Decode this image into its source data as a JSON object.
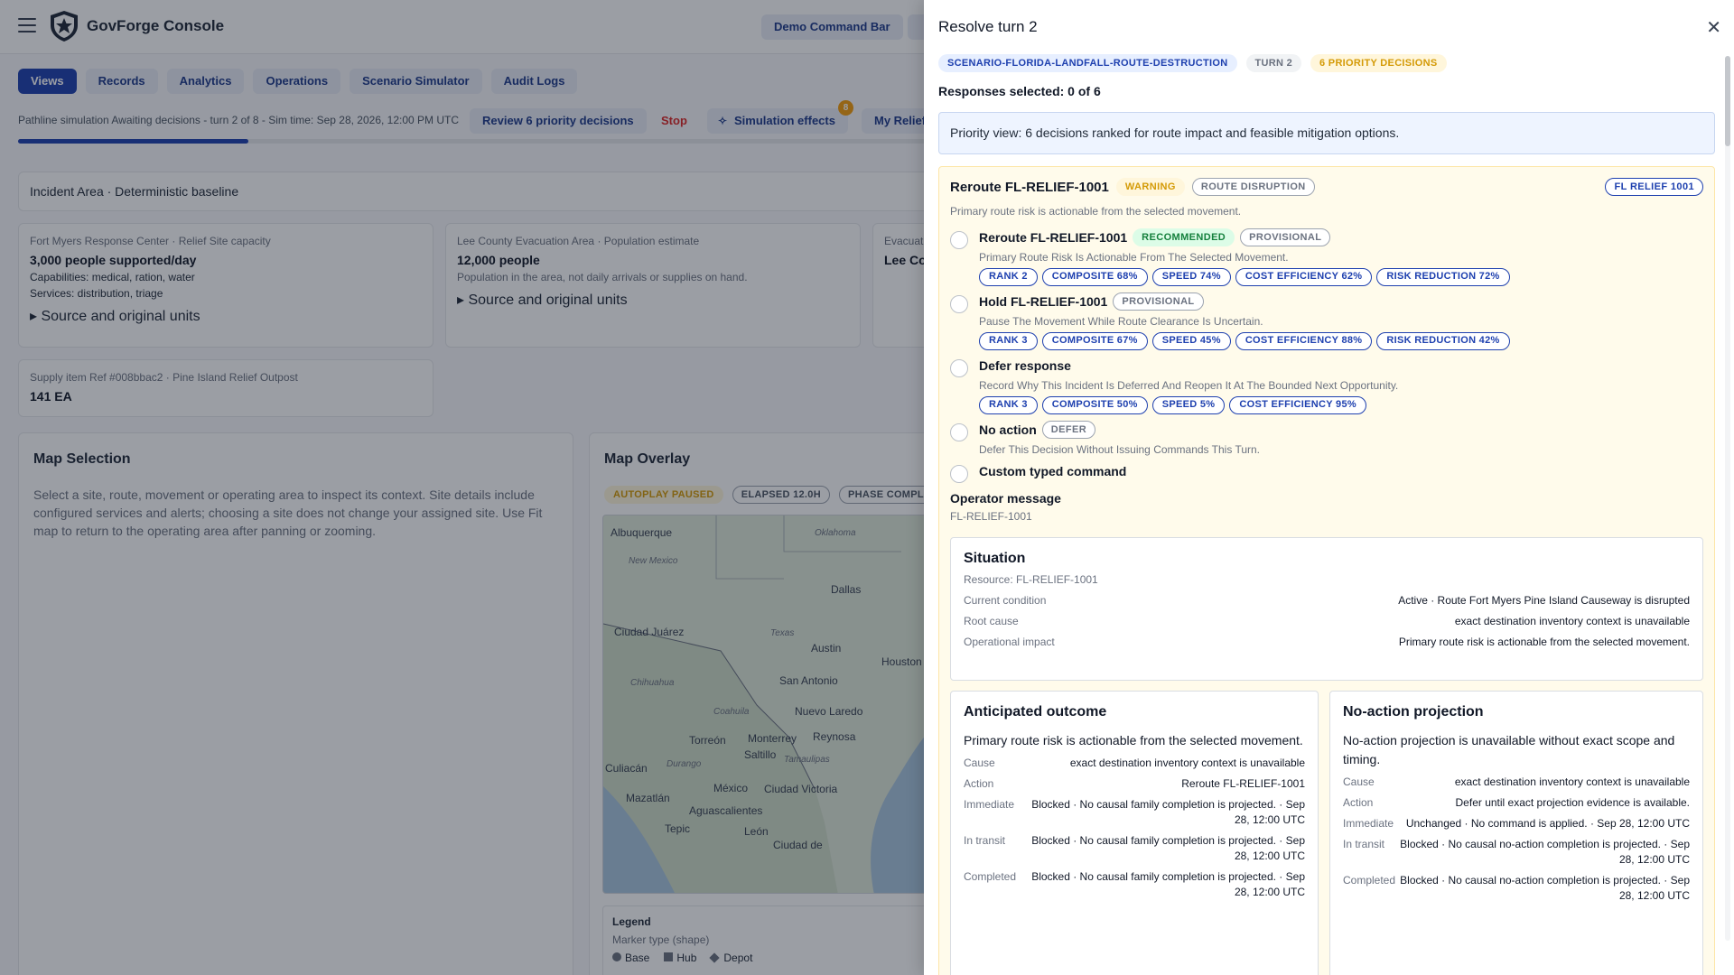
{
  "app": {
    "name": "GovForge Console",
    "demo_label": "Demo Command Bar"
  },
  "tabs": [
    "Views",
    "Records",
    "Analytics",
    "Operations",
    "Scenario Simulator",
    "Audit Logs"
  ],
  "sim": {
    "status_line": "Pathline simulation Awaiting decisions - turn 2 of 8 - Sim time: Sep 28, 2026, 12:00 PM UTC",
    "review_label": "Review 6 priority decisions",
    "stop_label": "Stop",
    "effects_label": "Simulation effects",
    "effects_badge": "8",
    "relief_label": "My Relief S",
    "progress": 0.25
  },
  "incident": "Incident Area · Deterministic baseline",
  "cards": [
    {
      "title": "Fort Myers Response Center · Relief Site capacity",
      "value": "3,000 people supported/day",
      "line1": "Capabilities: medical, ration, water",
      "line2": "Services: distribution, triage",
      "source": "Source and original units"
    },
    {
      "title": "Lee County Evacuation Area · Population estimate",
      "value": "12,000 people",
      "line1": "Population in the area, not daily arrivals or supplies on hand.",
      "source": "Source and original units"
    },
    {
      "title": "Evacuat",
      "value": "Lee Co"
    },
    {
      "title": "Supply item Ref #008bbac2 · Pine Island Relief Outpost",
      "value": "141 EA"
    }
  ],
  "map_selection": {
    "title": "Map Selection",
    "text": "Select a site, route, movement or operating area to inspect its context. Site details include configured services and alerts; choosing a site does not change your assigned site. Use Fit map to return to the operating area after panning or zooming."
  },
  "map_overlay": {
    "title": "Map Overlay",
    "pills": [
      "AUTOPLAY PAUSED",
      "ELAPSED 12.0H",
      "PHASE COMPL"
    ],
    "labels": [
      "Albuquerque",
      "Oklahoma",
      "New Mexico",
      "Dallas",
      "Ciudad Juárez",
      "Texas",
      "Austin",
      "Houston",
      "Chihuahua",
      "San Antonio",
      "Coahuila",
      "Nuevo Laredo",
      "Torreón",
      "Monterrey",
      "Reynosa",
      "Saltillo",
      "Culiacán",
      "Durango",
      "Tamaulipas",
      "México",
      "Mazatlán",
      "Ciudad Victoria",
      "Aguascalientes",
      "Tepic",
      "León",
      "Ciudad de"
    ],
    "legend": {
      "title": "Legend",
      "subtitle": "Marker type (shape)",
      "items": [
        "Base",
        "Hub",
        "Depot"
      ]
    }
  },
  "drawer": {
    "title": "Resolve turn 2",
    "pills": [
      "SCENARIO-FLORIDA-LANDFALL-ROUTE-DESTRUCTION",
      "TURN 2",
      "6 PRIORITY DECISIONS"
    ],
    "responses": "Responses selected: 0 of 6",
    "priority": "Priority view: 6 decisions ranked for route impact and feasible mitigation options.",
    "decision": {
      "title": "Reroute FL-RELIEF-1001",
      "severity": "WARNING",
      "category": "ROUTE DISRUPTION",
      "resource": "FL RELIEF 1001",
      "summary": "Primary route risk is actionable from the selected movement.",
      "options": [
        {
          "title": "Reroute FL-RELIEF-1001",
          "tags": [
            "RECOMMENDED",
            "PROVISIONAL"
          ],
          "desc": "Primary Route Risk Is Actionable From The Selected Movement.",
          "metrics": [
            "RANK 2",
            "COMPOSITE 68%",
            "SPEED 74%",
            "COST EFFICIENCY 62%",
            "RISK REDUCTION 72%"
          ]
        },
        {
          "title": "Hold FL-RELIEF-1001",
          "tags": [
            "PROVISIONAL"
          ],
          "desc": "Pause The Movement While Route Clearance Is Uncertain.",
          "metrics": [
            "RANK 3",
            "COMPOSITE 67%",
            "SPEED 45%",
            "COST EFFICIENCY 88%",
            "RISK REDUCTION 42%"
          ]
        },
        {
          "title": "Defer response",
          "tags": [],
          "desc": "Record Why This Incident Is Deferred And Reopen It At The Bounded Next Opportunity.",
          "metrics": [
            "RANK 3",
            "COMPOSITE 50%",
            "SPEED 5%",
            "COST EFFICIENCY 95%"
          ]
        },
        {
          "title": "No action",
          "tags": [
            "DEFER"
          ],
          "desc": "Defer This Decision Without Issuing Commands This Turn.",
          "metrics": []
        },
        {
          "title": "Custom typed command",
          "tags": [],
          "desc": "",
          "metrics": []
        }
      ],
      "operator_message": {
        "label": "Operator message",
        "value": "FL-RELIEF-1001"
      },
      "situation": {
        "title": "Situation",
        "resource": "Resource: FL-RELIEF-1001",
        "rows": [
          {
            "k": "Current condition",
            "v": "Active · Route Fort Myers Pine Island Causeway is disrupted"
          },
          {
            "k": "Root cause",
            "v": "exact destination inventory context is unavailable"
          },
          {
            "k": "Operational impact",
            "v": "Primary route risk is actionable from the selected movement."
          }
        ]
      },
      "anticipated": {
        "title": "Anticipated outcome",
        "lead": "Primary route risk is actionable from the selected movement.",
        "rows": [
          {
            "k": "Cause",
            "v": "exact destination inventory context is unavailable"
          },
          {
            "k": "Action",
            "v": "Reroute FL-RELIEF-1001"
          },
          {
            "k": "Immediate",
            "v": "Blocked · No causal family completion is projected. · Sep 28, 12:00 UTC"
          },
          {
            "k": "In transit",
            "v": "Blocked · No causal family completion is projected. · Sep 28, 12:00 UTC"
          },
          {
            "k": "Completed",
            "v": "Blocked · No causal family completion is projected. · Sep 28, 12:00 UTC"
          }
        ]
      },
      "noaction": {
        "title": "No-action projection",
        "lead": "No-action projection is unavailable without exact scope and timing.",
        "rows": [
          {
            "k": "Cause",
            "v": "exact destination inventory context is unavailable"
          },
          {
            "k": "Action",
            "v": "Defer until exact projection evidence is available."
          },
          {
            "k": "Immediate",
            "v": "Unchanged · No command is applied. · Sep 28, 12:00 UTC"
          },
          {
            "k": "In transit",
            "v": "Blocked · No causal no-action completion is projected. · Sep 28, 12:00 UTC"
          },
          {
            "k": "Completed",
            "v": "Blocked · No causal no-action completion is projected. · Sep 28, 12:00 UTC"
          }
        ]
      }
    }
  },
  "colors": {
    "primary": "#1e40af",
    "warning": "#d49a06",
    "danger": "#dc2626",
    "success": "#15803d"
  }
}
